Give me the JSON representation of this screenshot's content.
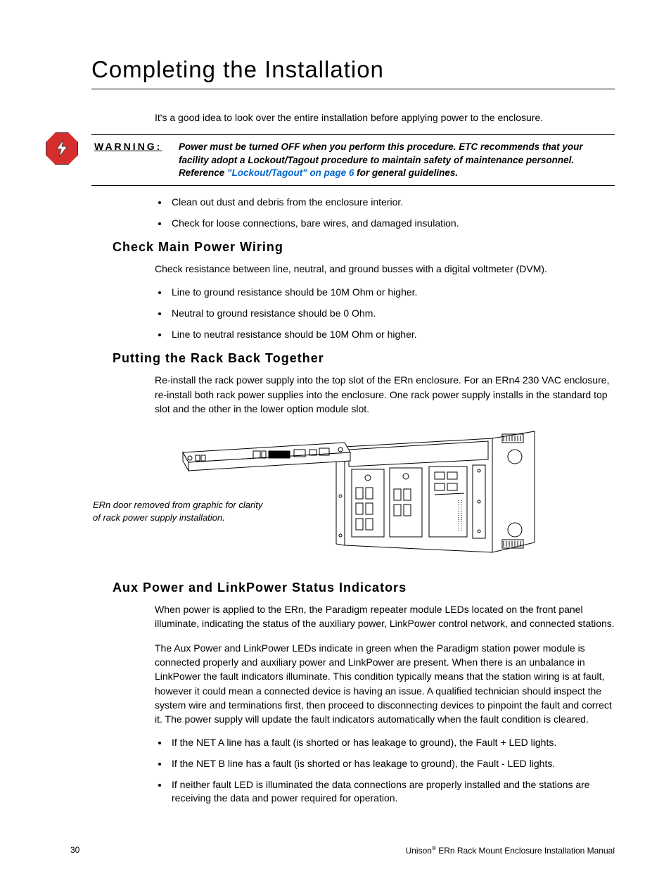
{
  "title": "Completing the Installation",
  "intro": "It's a good idea to look over the entire installation before applying power to the enclosure.",
  "warning": {
    "label": "WARNING:",
    "text_before_link": "Power must be turned OFF when you perform this procedure. ETC recommends that your facility adopt a Lockout/Tagout procedure to maintain safety of maintenance personnel. Reference ",
    "link_text": "\"Lockout/Tagout\" on page 6",
    "text_after_link": " for general guidelines."
  },
  "pre_items": [
    "Clean out dust and debris from the enclosure interior.",
    "Check for loose connections, bare wires, and damaged insulation."
  ],
  "sections": {
    "main_power": {
      "heading": "Check Main Power Wiring",
      "intro": "Check resistance between line, neutral, and ground busses with a digital voltmeter (DVM).",
      "items": [
        "Line to ground resistance should be 10M Ohm or higher.",
        "Neutral to ground resistance should be 0 Ohm.",
        "Line to neutral resistance should be 10M Ohm or higher."
      ]
    },
    "rack": {
      "heading": "Putting the Rack Back Together",
      "text": "Re-install the rack power supply into the top slot of the ERn enclosure. For an ERn4 230 VAC enclosure, re-install both rack power supplies into the enclosure. One rack power supply installs in the standard top slot and the other in the lower option module slot.",
      "caption": "ERn door removed from graphic for clarity of rack power supply installation."
    },
    "aux": {
      "heading": "Aux Power and LinkPower Status Indicators",
      "p1": "When power is applied to the ERn, the Paradigm repeater module LEDs located on the front panel illuminate, indicating the status of the auxiliary power, LinkPower control network, and connected stations.",
      "p2": "The Aux Power and LinkPower LEDs indicate in green when the Paradigm station power module is connected properly and auxiliary power and LinkPower are present. When there is an unbalance in LinkPower the fault indicators illuminate. This condition typically means that the station wiring is at fault, however it could mean a connected device is having an issue. A qualified technician should inspect the system wire and terminations first, then proceed to disconnecting devices to pinpoint the fault and correct it. The power supply will update the fault indicators automatically when the fault condition is cleared.",
      "items": [
        "If the NET A line has a fault (is shorted or has leakage to ground), the Fault + LED lights.",
        "If the NET B line has a fault (is shorted or has leakage to ground), the Fault - LED lights.",
        "If neither fault LED is illuminated the data connections are properly installed and the stations are receiving the data and power required for operation."
      ]
    }
  },
  "footer": {
    "page": "30",
    "doc_prefix": "Unison",
    "doc_suffix": " ERn Rack Mount Enclosure Installation Manual"
  }
}
